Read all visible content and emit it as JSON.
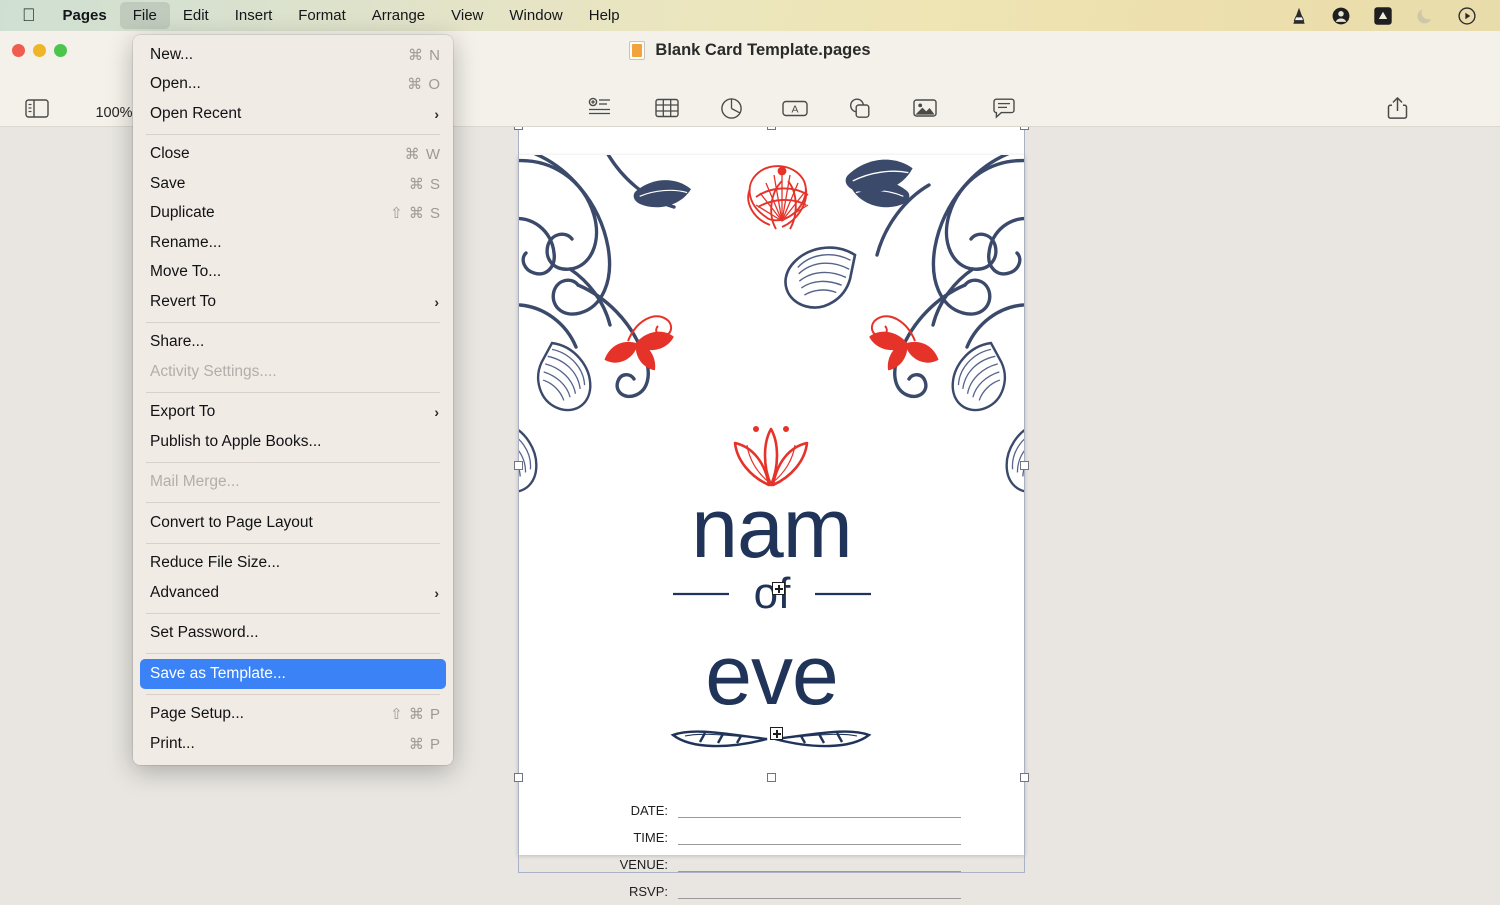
{
  "menubar": {
    "apple_glyph": "",
    "items": [
      {
        "label": "Pages",
        "bold": true,
        "active": false
      },
      {
        "label": "File",
        "bold": false,
        "active": true
      },
      {
        "label": "Edit",
        "bold": false,
        "active": false
      },
      {
        "label": "Insert",
        "bold": false,
        "active": false
      },
      {
        "label": "Format",
        "bold": false,
        "active": false
      },
      {
        "label": "Arrange",
        "bold": false,
        "active": false
      },
      {
        "label": "View",
        "bold": false,
        "active": false
      },
      {
        "label": "Window",
        "bold": false,
        "active": false
      },
      {
        "label": "Help",
        "bold": false,
        "active": false
      }
    ],
    "status_icons": [
      "vlc-cone-icon",
      "user-account-icon",
      "dropbox-icon",
      "moon-icon",
      "quicktime-play-icon"
    ],
    "gradient_left": "#cfe0d2",
    "gradient_right": "#e9dcab"
  },
  "window": {
    "document_title": "Blank Card Template.pages",
    "traffic_lights": [
      "close",
      "minimize",
      "zoom"
    ],
    "zoom_value": "100%",
    "zoom_label": "Zoom",
    "view_label": "View",
    "share_label": "Share",
    "toolbar": [
      {
        "label": "Insert",
        "icon": "insert-icon"
      },
      {
        "label": "Table",
        "icon": "table-icon"
      },
      {
        "label": "Chart",
        "icon": "chart-icon"
      },
      {
        "label": "Text",
        "icon": "text-icon"
      },
      {
        "label": "Shape",
        "icon": "shape-icon"
      },
      {
        "label": "Media",
        "icon": "media-icon"
      },
      {
        "label": "Comment",
        "icon": "comment-icon"
      }
    ]
  },
  "file_menu": {
    "groups": [
      [
        {
          "label": "New...",
          "shortcut": "⌘ N",
          "type": "item"
        },
        {
          "label": "Open...",
          "shortcut": "⌘ O",
          "type": "item"
        },
        {
          "label": "Open Recent",
          "shortcut": "",
          "type": "submenu"
        }
      ],
      [
        {
          "label": "Close",
          "shortcut": "⌘ W",
          "type": "item"
        },
        {
          "label": "Save",
          "shortcut": "⌘ S",
          "type": "item"
        },
        {
          "label": "Duplicate",
          "shortcut": "⇧ ⌘ S",
          "type": "item"
        },
        {
          "label": "Rename...",
          "shortcut": "",
          "type": "item"
        },
        {
          "label": "Move To...",
          "shortcut": "",
          "type": "item"
        },
        {
          "label": "Revert To",
          "shortcut": "",
          "type": "submenu"
        }
      ],
      [
        {
          "label": "Share...",
          "shortcut": "",
          "type": "item"
        },
        {
          "label": "Activity Settings....",
          "shortcut": "",
          "type": "disabled"
        }
      ],
      [
        {
          "label": "Export To",
          "shortcut": "",
          "type": "submenu"
        },
        {
          "label": "Publish to Apple Books...",
          "shortcut": "",
          "type": "item"
        }
      ],
      [
        {
          "label": "Mail Merge...",
          "shortcut": "",
          "type": "disabled"
        }
      ],
      [
        {
          "label": "Convert to Page Layout",
          "shortcut": "",
          "type": "item"
        }
      ],
      [
        {
          "label": "Reduce File Size...",
          "shortcut": "",
          "type": "item"
        },
        {
          "label": "Advanced",
          "shortcut": "",
          "type": "submenu"
        }
      ],
      [
        {
          "label": "Set Password...",
          "shortcut": "",
          "type": "item"
        }
      ],
      [
        {
          "label": "Save as Template...",
          "shortcut": "",
          "type": "selected"
        }
      ],
      [
        {
          "label": "Page Setup...",
          "shortcut": "⇧ ⌘ P",
          "type": "item"
        },
        {
          "label": "Print...",
          "shortcut": "⌘ P",
          "type": "item"
        }
      ]
    ],
    "highlight_color": "#3b82f6",
    "background_color": "#f1ebe6"
  },
  "document": {
    "card": {
      "title_line1": "nam",
      "title_line2": "of",
      "title_line3": "eve",
      "title_color": "#203358",
      "accent_color": "#e03224",
      "fields": [
        {
          "label": "DATE:",
          "value": ""
        },
        {
          "label": "TIME:",
          "value": ""
        },
        {
          "label": "VENUE:",
          "value": ""
        },
        {
          "label": "RSVP:",
          "value": ""
        }
      ]
    },
    "selection": {
      "handles": 8,
      "handle_color": "#ffffff",
      "border_color": "#a9b1c6"
    }
  }
}
